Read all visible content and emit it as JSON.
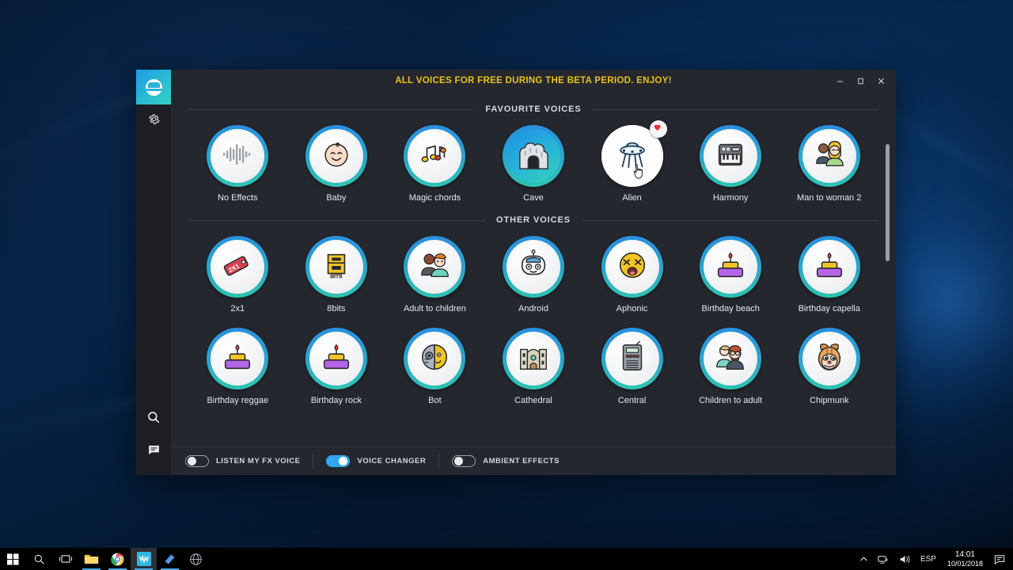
{
  "app": {
    "banner": "ALL VOICES FOR FREE DURING THE BETA PERIOD. ENJOY!",
    "accent_color": "#2fa8f0",
    "banner_color": "#e8c21c",
    "window_bg": "#24272e",
    "sidebar_bg": "#1c1e24"
  },
  "window_controls": {
    "minimize": "–",
    "maximize": "☐",
    "close": "✕"
  },
  "sidebar": {
    "logo_name": "voicemod-logo",
    "items": [
      {
        "name": "settings-icon",
        "label": "Settings"
      },
      {
        "name": "search-icon",
        "label": "Search"
      },
      {
        "name": "chat-icon",
        "label": "Chat"
      }
    ]
  },
  "sections": [
    {
      "title": "FAVOURITE VOICES",
      "voices": [
        {
          "label": "No Effects",
          "icon": "waveform-icon",
          "selected": false,
          "favourite": false,
          "hovered": false
        },
        {
          "label": "Baby",
          "icon": "baby-face-icon",
          "selected": false,
          "favourite": false,
          "hovered": false
        },
        {
          "label": "Magic chords",
          "icon": "music-notes-icon",
          "selected": false,
          "favourite": false,
          "hovered": false
        },
        {
          "label": "Cave",
          "icon": "cave-icon",
          "selected": true,
          "favourite": false,
          "hovered": false
        },
        {
          "label": "Alien",
          "icon": "ufo-icon",
          "selected": false,
          "favourite": true,
          "hovered": true
        },
        {
          "label": "Harmony",
          "icon": "keyboard-icon",
          "selected": false,
          "favourite": false,
          "hovered": false
        },
        {
          "label": "Man to woman 2",
          "icon": "man-to-woman-icon",
          "selected": false,
          "favourite": false,
          "hovered": false
        }
      ]
    },
    {
      "title": "OTHER VOICES",
      "voices": [
        {
          "label": "2x1",
          "icon": "price-tag-icon",
          "selected": false,
          "favourite": false,
          "hovered": false
        },
        {
          "label": "8bits",
          "icon": "8bits-icon",
          "selected": false,
          "favourite": false,
          "hovered": false
        },
        {
          "label": "Adult to children",
          "icon": "adult-to-children-icon",
          "selected": false,
          "favourite": false,
          "hovered": false
        },
        {
          "label": "Android",
          "icon": "android-robot-icon",
          "selected": false,
          "favourite": false,
          "hovered": false
        },
        {
          "label": "Aphonic",
          "icon": "aphonic-face-icon",
          "selected": false,
          "favourite": false,
          "hovered": false
        },
        {
          "label": "Birthday beach",
          "icon": "birthday-cake-icon",
          "selected": false,
          "favourite": false,
          "hovered": false
        },
        {
          "label": "Birthday capella",
          "icon": "birthday-cake-icon",
          "selected": false,
          "favourite": false,
          "hovered": false
        },
        {
          "label": "Birthday reggae",
          "icon": "birthday-cake-icon",
          "selected": false,
          "favourite": false,
          "hovered": false
        },
        {
          "label": "Birthday rock",
          "icon": "birthday-cake-icon",
          "selected": false,
          "favourite": false,
          "hovered": false
        },
        {
          "label": "Bot",
          "icon": "bot-face-icon",
          "selected": false,
          "favourite": false,
          "hovered": false
        },
        {
          "label": "Cathedral",
          "icon": "cathedral-icon",
          "selected": false,
          "favourite": false,
          "hovered": false
        },
        {
          "label": "Central",
          "icon": "radio-icon",
          "selected": false,
          "favourite": false,
          "hovered": false
        },
        {
          "label": "Children to adult",
          "icon": "children-to-adult-icon",
          "selected": false,
          "favourite": false,
          "hovered": false
        },
        {
          "label": "Chipmunk",
          "icon": "chipmunk-icon",
          "selected": false,
          "favourite": false,
          "hovered": false
        }
      ]
    }
  ],
  "bottom_toggles": [
    {
      "label": "LISTEN MY FX VOICE",
      "on": false
    },
    {
      "label": "VOICE CHANGER",
      "on": true
    },
    {
      "label": "AMBIENT EFFECTS",
      "on": false
    }
  ],
  "taskbar": {
    "icons": [
      {
        "name": "start-button",
        "running": false,
        "active": false
      },
      {
        "name": "search-taskbar-icon",
        "running": false,
        "active": false
      },
      {
        "name": "task-view-icon",
        "running": false,
        "active": false
      },
      {
        "name": "file-explorer-icon",
        "running": true,
        "active": false
      },
      {
        "name": "chrome-icon",
        "running": true,
        "active": false
      },
      {
        "name": "voicemod-taskbar-icon",
        "running": true,
        "active": true
      },
      {
        "name": "app-blue-icon",
        "running": true,
        "active": false
      },
      {
        "name": "browser-globe-icon",
        "running": false,
        "active": false
      }
    ],
    "tray": {
      "chevron": "∧",
      "language": "ESP",
      "time": "14:01",
      "date": "10/01/2018"
    }
  }
}
